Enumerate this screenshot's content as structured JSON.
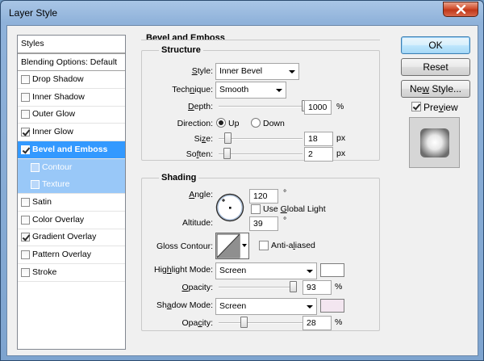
{
  "window": {
    "title": "Layer Style"
  },
  "styles_list": {
    "header": "Styles",
    "blending": "Blending Options: Default",
    "items": [
      {
        "label": "Drop Shadow",
        "checked": false
      },
      {
        "label": "Inner Shadow",
        "checked": false
      },
      {
        "label": "Outer Glow",
        "checked": false
      },
      {
        "label": "Inner Glow",
        "checked": true
      },
      {
        "label": "Bevel and Emboss",
        "checked": true,
        "selected": true
      },
      {
        "label": "Contour",
        "checked": false,
        "sub": true
      },
      {
        "label": "Texture",
        "checked": false,
        "sub": true
      },
      {
        "label": "Satin",
        "checked": false
      },
      {
        "label": "Color Overlay",
        "checked": false
      },
      {
        "label": "Gradient Overlay",
        "checked": true
      },
      {
        "label": "Pattern Overlay",
        "checked": false
      },
      {
        "label": "Stroke",
        "checked": false
      }
    ]
  },
  "bevel": {
    "section_title": "Bevel and Emboss",
    "structure": {
      "title": "Structure",
      "style_label": "Style:",
      "style_value": "Inner Bevel",
      "technique_label": "Technique:",
      "technique_value": "Smooth",
      "depth_label": "Depth:",
      "depth_value": "1000",
      "depth_unit": "%",
      "depth_level": 1.0,
      "direction_label": "Direction:",
      "direction_up": "Up",
      "direction_down": "Down",
      "direction_selected": "Up",
      "size_label": "Size:",
      "size_value": "18",
      "size_unit": "px",
      "size_level": 0.07,
      "soften_label": "Soften:",
      "soften_value": "2",
      "soften_unit": "px",
      "soften_level": 0.06
    },
    "shading": {
      "title": "Shading",
      "angle_label": "Angle:",
      "angle_value": "120",
      "angle_unit": "°",
      "use_global_light": "Use Global Light",
      "use_global_light_checked": false,
      "altitude_label": "Altitude:",
      "altitude_value": "39",
      "altitude_unit": "°",
      "gloss_contour_label": "Gloss Contour:",
      "anti_aliased": "Anti-aliased",
      "anti_aliased_checked": false,
      "highlight_mode_label": "Highlight Mode:",
      "highlight_mode_value": "Screen",
      "highlight_color": "#ffffff",
      "highlight_opacity_label": "Opacity:",
      "highlight_opacity_value": "93",
      "highlight_opacity_unit": "%",
      "highlight_opacity_level": 0.93,
      "shadow_mode_label": "Shadow Mode:",
      "shadow_mode_value": "Screen",
      "shadow_color": "#f3e6f0",
      "shadow_opacity_label": "Opacity:",
      "shadow_opacity_value": "28",
      "shadow_opacity_unit": "%",
      "shadow_opacity_level": 0.28
    }
  },
  "buttons": {
    "ok": "OK",
    "reset": "Reset",
    "new_style": "New Style...",
    "preview": "Preview",
    "preview_checked": true
  }
}
